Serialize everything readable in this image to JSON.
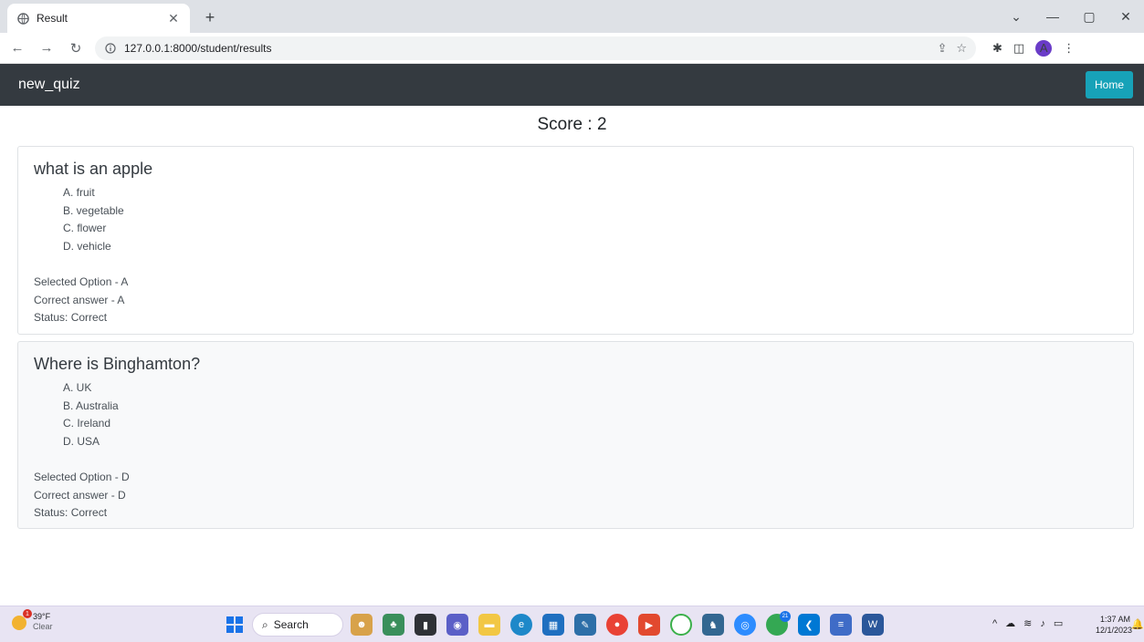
{
  "browser": {
    "tab_title": "Result",
    "url": "127.0.0.1:8000/student/results",
    "avatar_letter": "A"
  },
  "navbar": {
    "brand": "new_quiz",
    "home_label": "Home"
  },
  "score_text": "Score : 2",
  "questions": [
    {
      "text": "what is an apple",
      "options": [
        "A. fruit",
        "B. vegetable",
        "C. flower",
        "D. vehicle"
      ],
      "selected": "Selected Option - A",
      "correct": "Correct answer - A",
      "status": "Status: Correct"
    },
    {
      "text": "Where is Binghamton?",
      "options": [
        "A. UK",
        "B. Australia",
        "C. Ireland",
        "D. USA"
      ],
      "selected": "Selected Option - D",
      "correct": "Correct answer - D",
      "status": "Status: Correct"
    }
  ],
  "taskbar": {
    "weather_temp": "39°F",
    "weather_cond": "Clear",
    "weather_badge": "1",
    "search_label": "Search",
    "clock_time": "1:37 AM",
    "clock_date": "12/1/2023",
    "chrome_badge": "21"
  },
  "colors": {
    "navbar_bg": "#343a40",
    "home_button": "#17a2b8",
    "taskbar_bg": "#e8e4f3"
  }
}
